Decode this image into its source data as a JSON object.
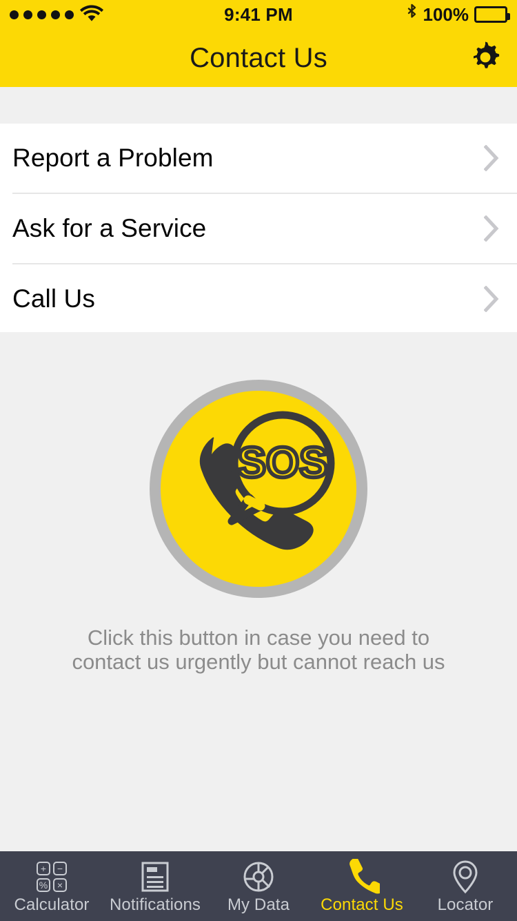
{
  "status_bar": {
    "signal_dots": 5,
    "wifi_icon": "wifi-icon",
    "time": "9:41 PM",
    "bluetooth_icon": "bluetooth-icon",
    "battery_percent": "100%",
    "battery_icon": "battery-full-icon"
  },
  "nav": {
    "title": "Contact Us",
    "settings_icon": "gear-icon"
  },
  "list": {
    "rows": [
      {
        "label": "Report a Problem",
        "chevron": "chevron-right-icon"
      },
      {
        "label": "Ask for a Service",
        "chevron": "chevron-right-icon"
      },
      {
        "label": "Call Us",
        "chevron": "chevron-right-icon"
      }
    ]
  },
  "sos": {
    "icon": "sos-emergency-call-icon",
    "badge_text": "SOS",
    "caption_line1": "Click this button in case you need to",
    "caption_line2": "contact us urgently but cannot reach us"
  },
  "tabbar": {
    "items": [
      {
        "label": "Calculator",
        "icon": "calculator-icon",
        "active": false
      },
      {
        "label": "Notifications",
        "icon": "document-lines-icon",
        "active": false
      },
      {
        "label": "My Data",
        "icon": "pie-chart-icon",
        "active": false
      },
      {
        "label": "Contact Us",
        "icon": "phone-handset-icon",
        "active": true
      },
      {
        "label": "Locator",
        "icon": "map-pin-icon",
        "active": false
      }
    ],
    "calculator_keys": [
      "+",
      "−",
      "%",
      "×"
    ]
  },
  "colors": {
    "brand_yellow": "#FCD905",
    "tabbar_background": "#3f4250",
    "tab_inactive": "#c9ccd2",
    "page_background": "#f0f0f0",
    "list_background": "#ffffff",
    "caption_text": "#8b8b8b",
    "sos_ring": "#b5b5b5",
    "sos_glyph": "#3a3a3c"
  }
}
